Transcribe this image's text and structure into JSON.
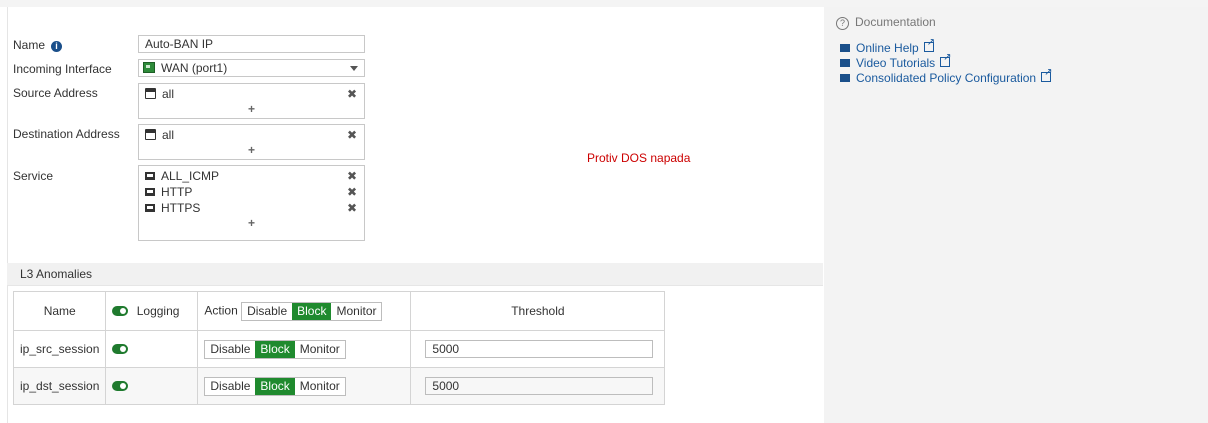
{
  "form": {
    "name_label": "Name",
    "name_value": "Auto-BAN IP",
    "interface_label": "Incoming Interface",
    "interface_value": "WAN (port1)",
    "source_label": "Source Address",
    "source_items": [
      "all"
    ],
    "destination_label": "Destination Address",
    "destination_items": [
      "all"
    ],
    "service_label": "Service",
    "service_items": [
      "ALL_ICMP",
      "HTTP",
      "HTTPS"
    ],
    "add_symbol": "+",
    "remove_symbol": "✖",
    "comment": "Protiv DOS napada"
  },
  "anomalies": {
    "section_title": "L3 Anomalies",
    "header": {
      "name": "Name",
      "logging": "Logging",
      "action": "Action",
      "threshold": "Threshold",
      "action_options": [
        "Disable",
        "Block",
        "Monitor"
      ],
      "action_selected": "Block"
    },
    "rows": [
      {
        "name": "ip_src_session",
        "logging": true,
        "action_selected": "Block",
        "threshold": "5000"
      },
      {
        "name": "ip_dst_session",
        "logging": true,
        "action_selected": "Block",
        "threshold": "5000"
      }
    ]
  },
  "documentation": {
    "title": "Documentation",
    "links": [
      {
        "label": "Online Help",
        "icon": "book-icon"
      },
      {
        "label": "Video Tutorials",
        "icon": "video-icon"
      },
      {
        "label": "Consolidated Policy Configuration",
        "icon": "video-icon"
      }
    ]
  },
  "colors": {
    "accent_green": "#1f8a2e",
    "link_blue": "#1a5a9e",
    "comment_red": "#cc0000"
  }
}
